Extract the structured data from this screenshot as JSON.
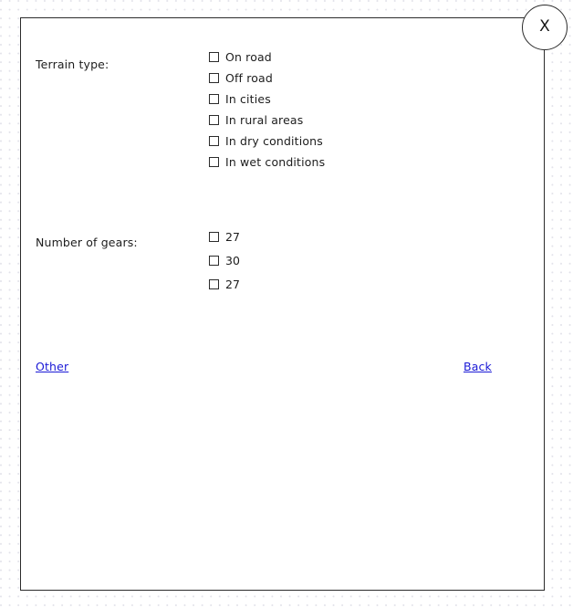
{
  "dialog": {
    "close_button": {
      "icon": "close-x-icon",
      "label": "X"
    },
    "groups": [
      {
        "key": "terrain",
        "label": "Terrain type:",
        "options": [
          {
            "label": "On road",
            "checked": false
          },
          {
            "label": "Off road",
            "checked": false
          },
          {
            "label": "In cities",
            "checked": false
          },
          {
            "label": "In rural areas",
            "checked": false
          },
          {
            "label": "In dry conditions",
            "checked": false
          },
          {
            "label": "In wet conditions",
            "checked": false
          }
        ]
      },
      {
        "key": "gears",
        "label": "Number of gears:",
        "options": [
          {
            "label": "27",
            "checked": false
          },
          {
            "label": "30",
            "checked": false
          },
          {
            "label": "27",
            "checked": false
          }
        ]
      }
    ],
    "links": {
      "other": "Other",
      "back": "Back"
    }
  },
  "colors": {
    "border": "#2b2b2b",
    "text": "#1d1d1d",
    "link": "#1a19d6",
    "panel_bg": "#ffffff",
    "page_bg": "#ffffff",
    "grid_dot": "#a0a0b9"
  }
}
